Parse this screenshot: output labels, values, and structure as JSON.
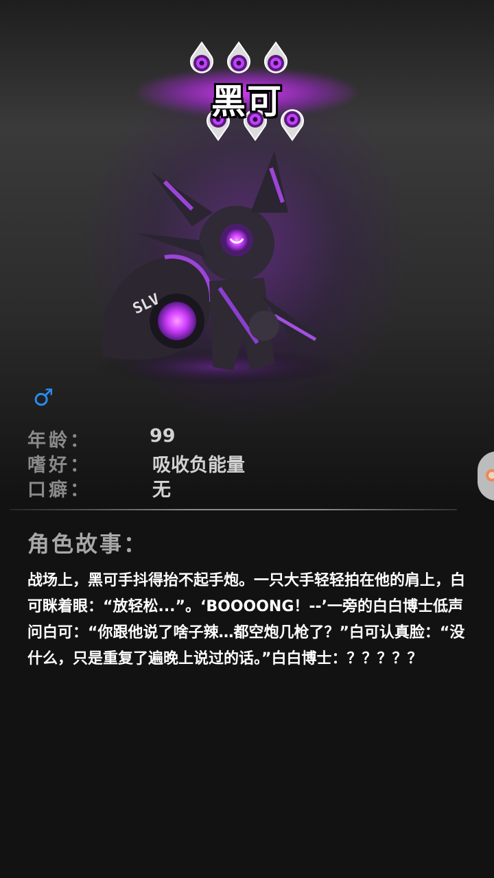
{
  "character": {
    "name": "黑可",
    "gender_symbol": "♂",
    "rank_badges": 6
  },
  "info": {
    "age_label": "年龄：",
    "age_value": "99",
    "hobby_label": "嗜好：",
    "hobby_value": "吸收负能量",
    "catchphrase_label": "口癖：",
    "catchphrase_value": "无"
  },
  "story": {
    "heading": "角色故事：",
    "text": "战场上，黑可手抖得抬不起手炮。一只大手轻轻拍在他的肩上，白可眯着眼：“放轻松...”。‘BOOOONG！--’一旁的白白博士低声问白可：“你跟他说了啥子辣…都空炮几枪了？”白可认真脸：“没什么，只是重复了遍晚上说过的话。”白白博士：？？？？？"
  },
  "colors": {
    "accent_purple": "#c040ff",
    "gender_blue": "#2a8cf0",
    "label_gray": "#8a8a8a"
  },
  "icons": {
    "gender": "male-symbol-icon",
    "side_tab": "side-tab-icon",
    "badge": "eye-drop-badge-icon"
  }
}
